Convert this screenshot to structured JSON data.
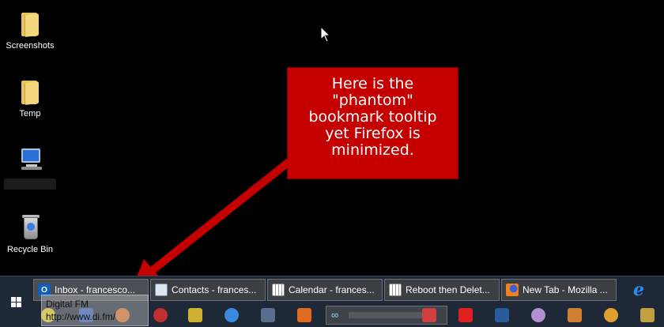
{
  "desktop": {
    "icons": [
      {
        "label": "Screenshots",
        "icon": "folder-icon"
      },
      {
        "label": "Temp",
        "icon": "folder-icon"
      },
      {
        "label": "",
        "icon": "computer-icon"
      },
      {
        "label": "Recycle Bin",
        "icon": "recycle-bin-icon"
      }
    ]
  },
  "callout": {
    "lines": [
      "Here is the",
      "\"phantom\"",
      "bookmark tooltip",
      "yet Firefox is",
      "minimized."
    ],
    "color": "#c40000"
  },
  "taskbar": {
    "start_icon": "windows-logo-icon",
    "buttons": [
      {
        "label": "Inbox - francesco...",
        "icon": "outlook-icon"
      },
      {
        "label": "Contacts - frances...",
        "icon": "contacts-icon"
      },
      {
        "label": "Calendar - frances...",
        "icon": "calendar-icon"
      },
      {
        "label": "Reboot then Delet...",
        "icon": "calendar-icon"
      },
      {
        "label": "New Tab - Mozilla ...",
        "icon": "firefox-icon"
      }
    ],
    "pinned_icon": "internet-explorer-icon",
    "accent": "#1e2836"
  },
  "tooltip": {
    "title": "Digital FM",
    "url": "http://www.di.fm/"
  }
}
